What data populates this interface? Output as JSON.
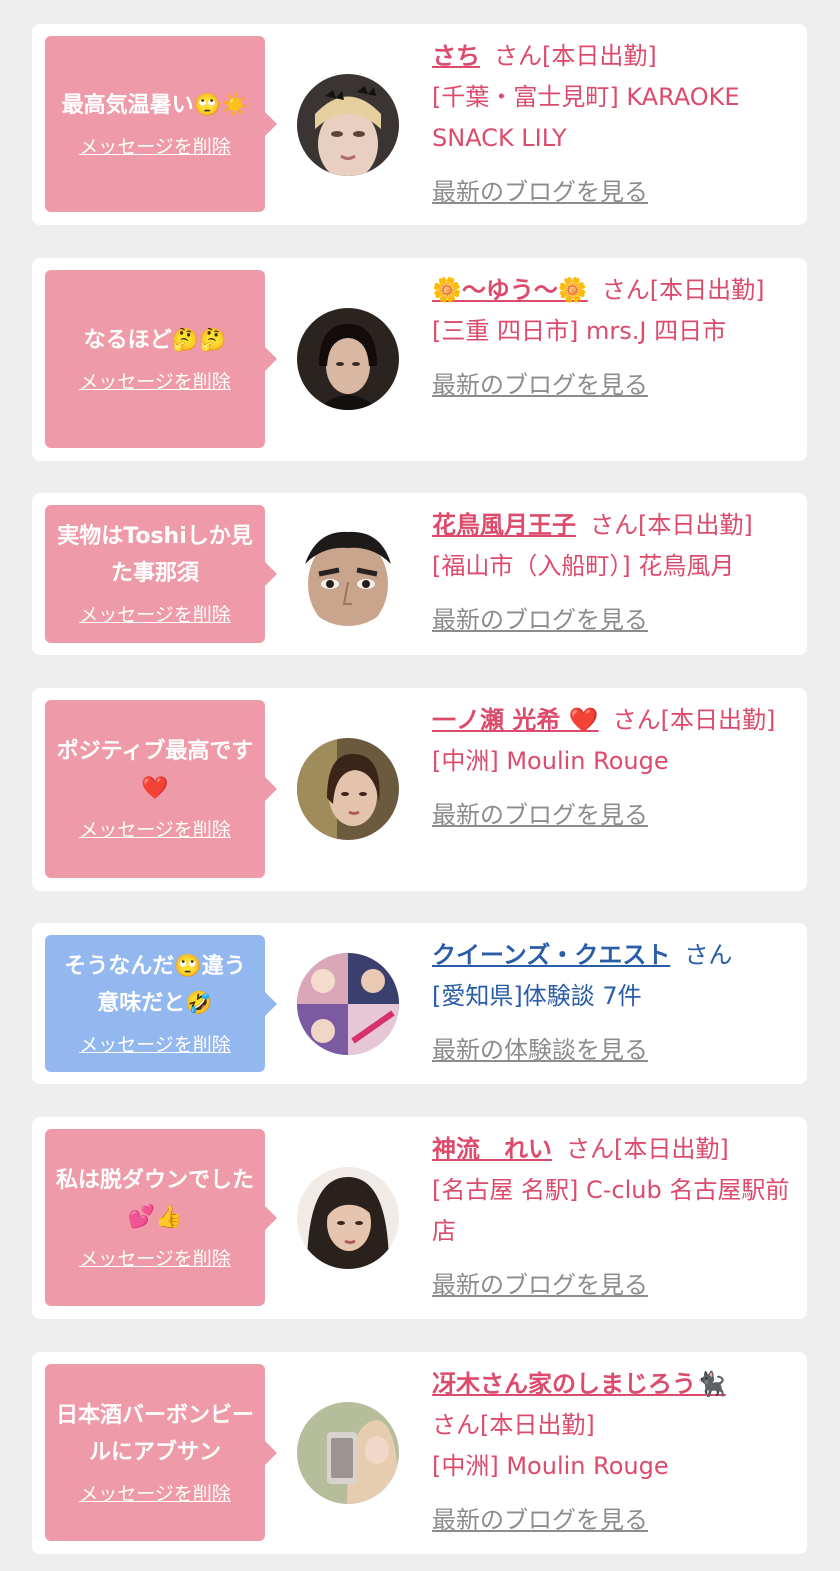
{
  "delete_label": "メッセージを削除",
  "items": [
    {
      "message": "最高気温暑い🙄☀️",
      "name": "さち",
      "suffix": "さん[本日出勤]",
      "shop": "[千葉・富士見町] KARAOKE SNACK LILY",
      "blog_link": "最新のブログを見る",
      "avatar": "woman-with-bow-avatar"
    },
    {
      "message": "なるほど🤔🤔",
      "name": "🌼〜ゆう〜🌼",
      "suffix": "さん[本日出勤]",
      "shop": "[三重 四日市] mrs.J 四日市",
      "blog_link": "最新のブログを見る",
      "avatar": "dark-hair-woman-avatar"
    },
    {
      "message": "実物はToshiしか見た事那須",
      "name": "花鳥風月王子",
      "suffix": "さん[本日出勤]",
      "shop": "[福山市（入船町）] 花鳥風月",
      "blog_link": "最新のブログを見る",
      "avatar": "man-face-avatar"
    },
    {
      "message": "ポジティブ最高です❤️",
      "name": "一ノ瀬 光希 ❤️",
      "suffix": "さん[本日出勤]",
      "shop": "[中洲] Moulin Rouge",
      "blog_link": "最新のブログを見る",
      "avatar": "woman-portrait-avatar"
    },
    {
      "message": "そうなんだ🙄違う意味だと🤣",
      "name": "クイーンズ・クエスト",
      "suffix": "さん",
      "shop": "[愛知県]体験談 7件",
      "blog_link": "最新の体験談を見る",
      "avatar": "anime-collage-avatar",
      "theme": "blue"
    },
    {
      "message": "私は脱ダウンでした💕👍",
      "name": "神流　れい",
      "suffix": "さん[本日出勤]",
      "shop": "[名古屋 名駅] C-club 名古屋駅前店",
      "blog_link": "最新のブログを見る",
      "avatar": "woman-closeup-avatar"
    },
    {
      "message": "日本酒バーボンビールにアブサン",
      "name": "冴木さん家のしまじろう🐈‍⬛",
      "suffix": "さん[本日出勤]",
      "shop": "[中洲] Moulin Rouge",
      "blog_link": "最新のブログを見る",
      "avatar": "selfie-phone-avatar"
    }
  ]
}
